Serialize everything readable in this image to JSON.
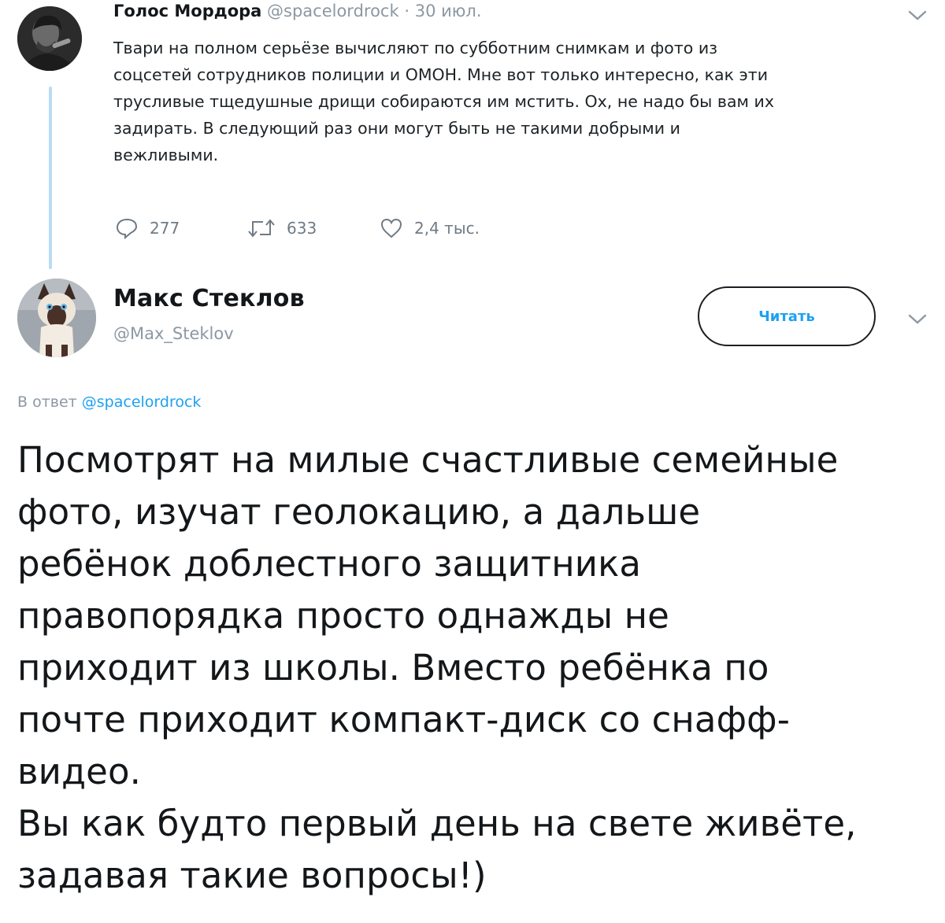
{
  "parent_tweet": {
    "display_name": "Голос Мордора",
    "handle": "@spacelordrock",
    "separator": "·",
    "date": "30 июл.",
    "lines": [
      "Твари на полном серьёзе вычисляют по субботним снимкам и фото из",
      "соцсетей сотрудников полиции и ОМОН. Мне вот только интересно, как эти",
      "трусливые тщедушные дрищи собираются им мстить. Ох, не надо бы вам их",
      "задирать. В следующий раз они могут быть не такими добрыми и",
      "вежливыми."
    ],
    "actions": {
      "reply_count": "277",
      "retweet_count": "633",
      "like_count": "2,4 тыс."
    },
    "icons": [
      "chevron-down-icon",
      "reply-icon",
      "retweet-icon",
      "like-icon"
    ]
  },
  "reply_tweet": {
    "display_name": "Макс Стеклов",
    "handle": "@Max_Steklov",
    "follow_label": "Читать",
    "reply_prefix": "В ответ",
    "reply_handle": "@spacelordrock",
    "lines": [
      "Посмотрят на милые счастливые семейные",
      "фото, изучат геолокацию, а дальше",
      "ребёнок доблестного защитника",
      "правопорядка просто однажды не",
      "приходит из школы. Вместо ребёнка по",
      "почте приходит компакт-диск со снафф-",
      "видео.",
      "Вы как будто первый день на свете живёте,",
      "задавая такие вопросы!)"
    ],
    "icons": [
      "chevron-down-icon"
    ]
  },
  "colors": {
    "accent": "#1da1f2",
    "thread_line": "#b9dcf4",
    "secondary_text": "#8d98a3"
  }
}
